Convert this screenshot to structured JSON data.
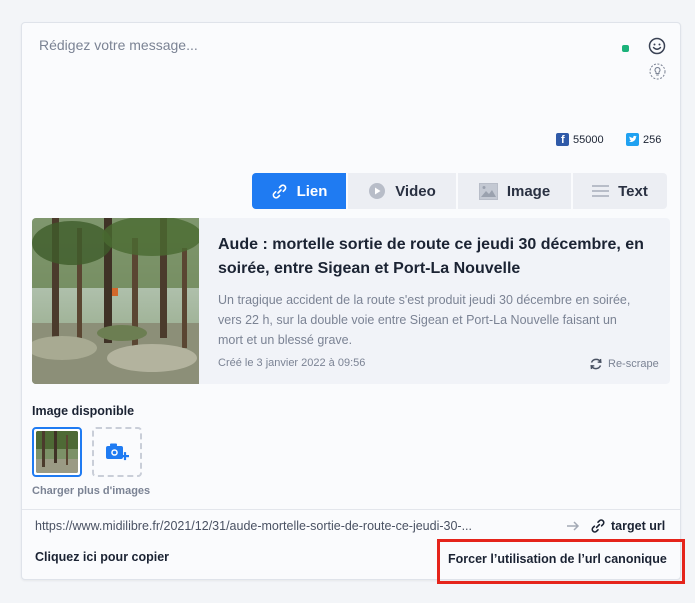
{
  "composer": {
    "placeholder": "Rédigez votre message...",
    "status_color": "#1bb27a",
    "icons": [
      "emoji-icon",
      "lightbulb-icon"
    ]
  },
  "social": {
    "facebook": {
      "count": "55000",
      "color": "#2f5aa8"
    },
    "twitter": {
      "count": "256",
      "color": "#1fa1f1"
    }
  },
  "tabs": [
    {
      "label": "Lien",
      "icon": "link-icon",
      "active": true
    },
    {
      "label": "Video",
      "icon": "play-icon",
      "active": false
    },
    {
      "label": "Image",
      "icon": "image-icon",
      "active": false
    },
    {
      "label": "Text",
      "icon": "text-lines-icon",
      "active": false
    }
  ],
  "accent_color": "#1f7bf2",
  "article": {
    "title": "Aude : mortelle sortie de route ce jeudi 30 décembre, en soirée, entre Sigean et Port-La Nouvelle",
    "description": "Un tragique accident de la route s'est produit jeudi 30 décembre en soirée, vers 22 h, sur la double voie entre Sigean et Port-La Nouvelle faisant un mort et un blessé grave.",
    "created": "Créé le 3 janvier 2022 à 09:56",
    "rescrape_label": "Re-scrape"
  },
  "images": {
    "label": "Image disponible",
    "load_more": "Charger plus d'images"
  },
  "link": {
    "url": "https://www.midilibre.fr/2021/12/31/aude-mortelle-sortie-de-route-ce-jeudi-30-...",
    "target_label": "target url",
    "copy_label": "Cliquez ici pour copier",
    "canonical_label": "Forcer l’utilisation de l’url canonique",
    "highlight_color": "#e5241b"
  }
}
